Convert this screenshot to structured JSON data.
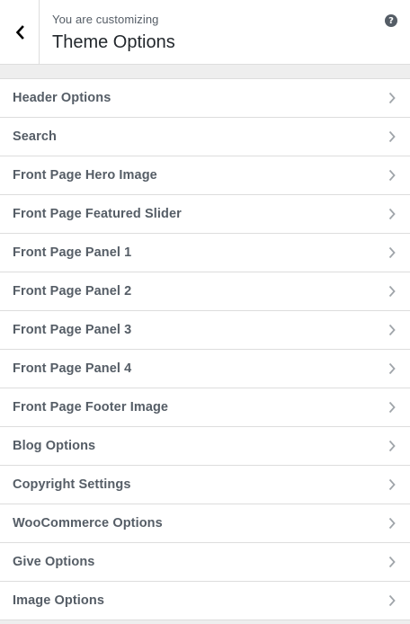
{
  "header": {
    "subtitle": "You are customizing",
    "title": "Theme Options",
    "back_icon": "chevron-left-icon",
    "help_icon": "question-mark-icon",
    "help_glyph": "?"
  },
  "menu": {
    "items": [
      {
        "label": "Header Options"
      },
      {
        "label": "Search"
      },
      {
        "label": "Front Page Hero Image"
      },
      {
        "label": "Front Page Featured Slider"
      },
      {
        "label": "Front Page Panel 1"
      },
      {
        "label": "Front Page Panel 2"
      },
      {
        "label": "Front Page Panel 3"
      },
      {
        "label": "Front Page Panel 4"
      },
      {
        "label": "Front Page Footer Image"
      },
      {
        "label": "Blog Options"
      },
      {
        "label": "Copyright Settings"
      },
      {
        "label": "WooCommerce Options"
      },
      {
        "label": "Give Options"
      },
      {
        "label": "Image Options"
      }
    ],
    "item_icon": "chevron-right-icon"
  },
  "colors": {
    "background": "#eeeeee",
    "panel": "#ffffff",
    "border": "#dddddd",
    "text": "#555d66",
    "title": "#23282d",
    "chevron": "#a0a5aa"
  }
}
